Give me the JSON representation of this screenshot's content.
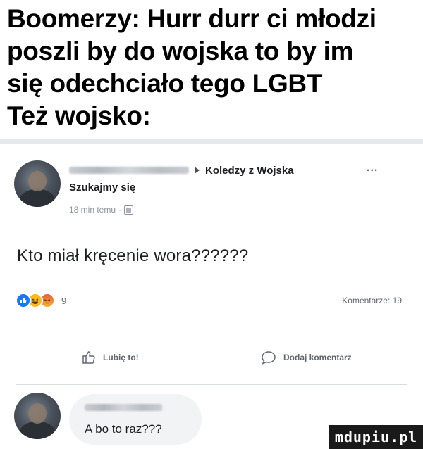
{
  "meme": {
    "caption_lines": [
      "Boomerzy: Hurr durr ci młodzi",
      "poszli by do wojska to by im",
      "się odechciało tego LGBT",
      "Też wojsko:"
    ]
  },
  "post": {
    "group_name": "Koledzy z Wojska",
    "author_name": "Szukajmy się",
    "timestamp": "18 min temu",
    "privacy_icon": "group-icon",
    "more_label": "...",
    "text": "Kto  miał kręcenie wora??????",
    "reactions": {
      "icons": [
        "like-icon",
        "haha-icon",
        "angry-icon"
      ],
      "count": "9",
      "comments_label": "Komentarze: 19"
    },
    "actions": {
      "like_label": "Lubię to!",
      "comment_label": "Dodaj komentarz"
    },
    "comment": {
      "text": "A bo to raz???"
    }
  },
  "watermark": {
    "text": "mdupiu.pl"
  },
  "colors": {
    "like_blue": "#1877f2",
    "text_dark": "#1c1e21",
    "text_muted": "#606770",
    "bubble_bg": "#f2f3f5"
  }
}
